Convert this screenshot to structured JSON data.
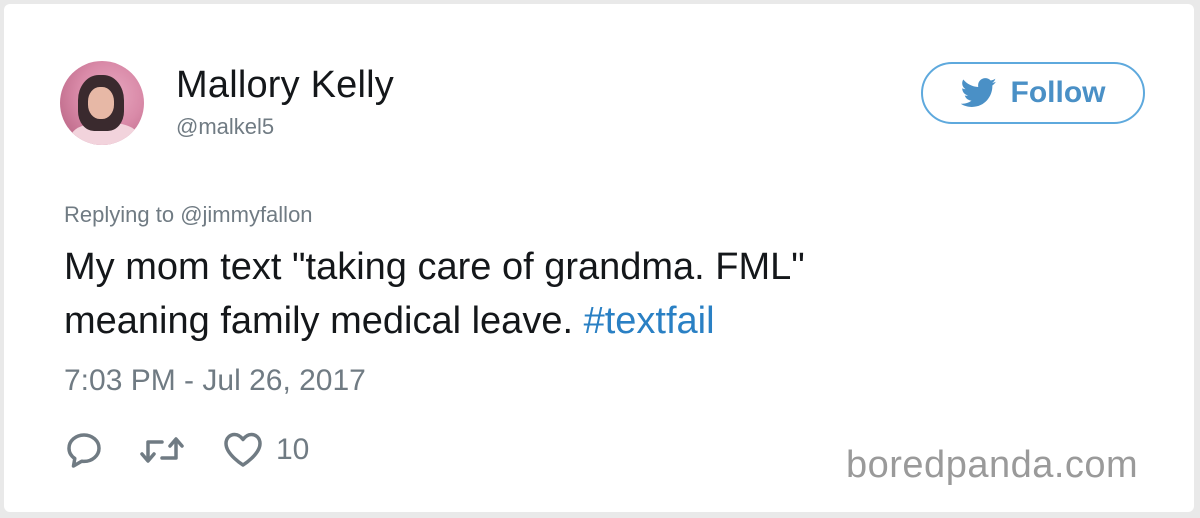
{
  "author": {
    "name": "Mallory Kelly",
    "handle": "@malkel5"
  },
  "follow_button": {
    "label": "Follow",
    "icon": "twitter-bird-icon"
  },
  "reply_to": {
    "prefix": "Replying to ",
    "mention": "@jimmyfallon"
  },
  "tweet": {
    "line1": "My mom text \"taking care of grandma. FML\"",
    "line2_text": "meaning family medical leave. ",
    "hashtag": "#textfail"
  },
  "timestamp": "7:03 PM - Jul 26, 2017",
  "actions": {
    "reply_icon": "reply-icon",
    "retweet_icon": "retweet-icon",
    "like_icon": "heart-icon",
    "like_count": "10"
  },
  "watermark": "boredpanda.com",
  "colors": {
    "accent": "#2a80c4",
    "follow_border": "#5ea9dd",
    "muted": "#707b83",
    "text": "#14171a"
  }
}
